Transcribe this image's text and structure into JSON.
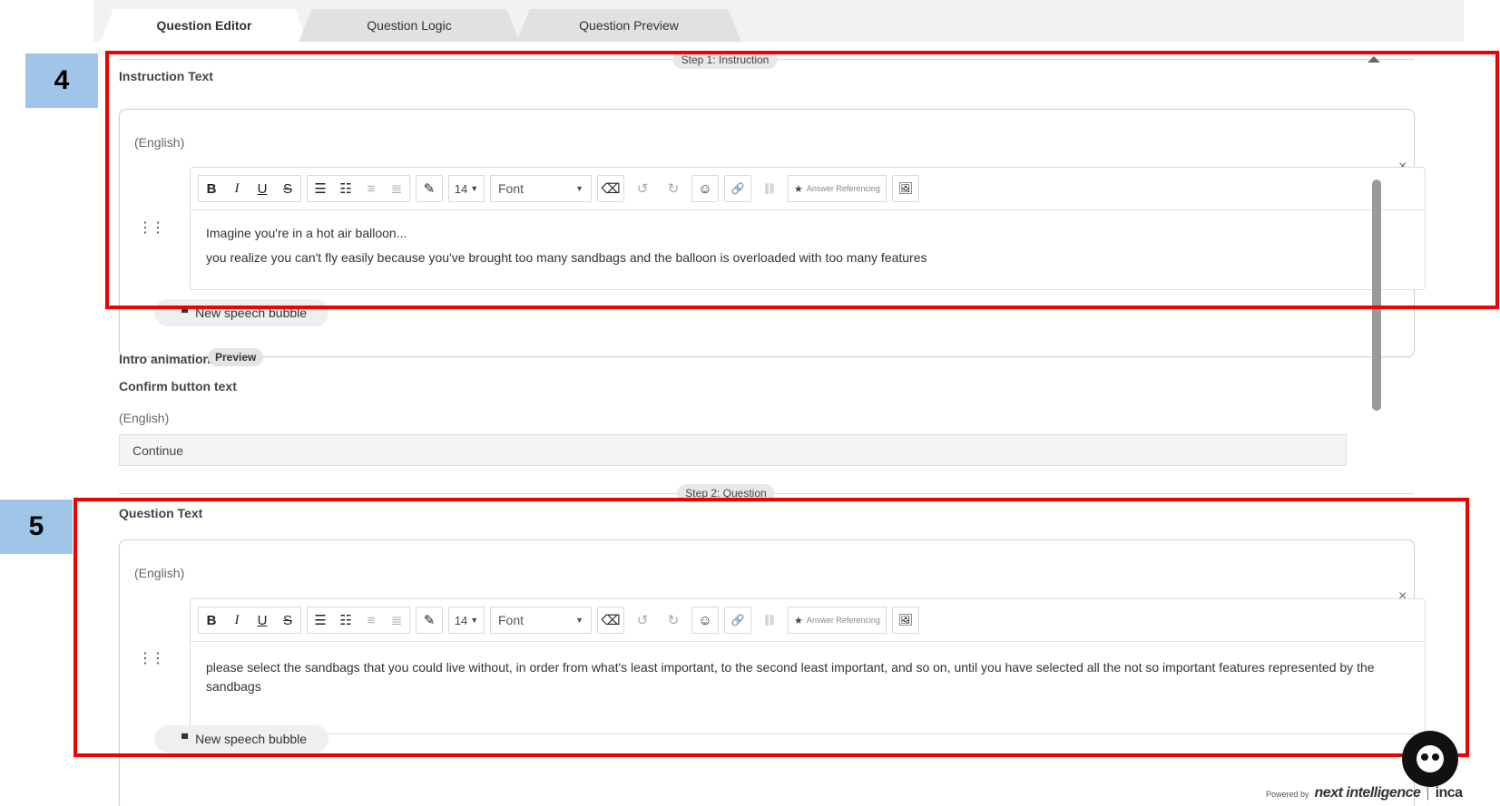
{
  "tabs": [
    {
      "label": "Question Editor",
      "active": true
    },
    {
      "label": "Question Logic",
      "active": false
    },
    {
      "label": "Question Preview",
      "active": false
    }
  ],
  "step1": {
    "pill": "Step 1: Instruction",
    "section_label": "Instruction Text",
    "language": "(English)",
    "toolbar": {
      "font_size": "14",
      "font": "Font",
      "answer_ref": "Answer Referencing"
    },
    "text_lines": [
      "Imagine you're in a hot air balloon...",
      "you realize you can't fly easily because you've brought too many sandbags and the balloon is overloaded with too many features"
    ],
    "close_glyph": "×",
    "new_bubble": "New speech bubble"
  },
  "intro_animation": {
    "label": "Intro animation",
    "preview": "Preview"
  },
  "confirm": {
    "label": "Confirm button text",
    "language": "(English)",
    "value": "Continue"
  },
  "step2": {
    "pill": "Step 2: Question",
    "section_label": "Question Text",
    "language": "(English)",
    "toolbar": {
      "font_size": "14",
      "font": "Font",
      "answer_ref": "Answer Referencing"
    },
    "text_lines": [
      "please select the sandbags that you could live without, in order from what's least important, to the second least important, and so on, until you have selected all the not so important features represented by the",
      "sandbags"
    ],
    "close_glyph": "×",
    "new_bubble": "New speech bubble"
  },
  "annotations": {
    "badge_4": "4",
    "badge_5": "5",
    "highlight_color": "#ee0000",
    "badge_color": "#9fc5e8"
  },
  "footer": {
    "powered_by": "Powered by",
    "brand": "next intelligence",
    "separator": "|",
    "product": "inca"
  },
  "icons": {
    "bold": "B",
    "italic": "I",
    "underline": "U",
    "strike": "S",
    "bullet_list": "☰",
    "numbered_list": "☷",
    "outdent": "≡",
    "indent": "≣",
    "pen": "✎",
    "dropdown": "▼",
    "eraser": "⌫",
    "undo": "↺",
    "redo": "↻",
    "emoji": "☺",
    "link": "🔗",
    "unlink": "⛓",
    "star": "★",
    "image": "🖼",
    "drag": "⋮⋮",
    "speech": "▀"
  }
}
